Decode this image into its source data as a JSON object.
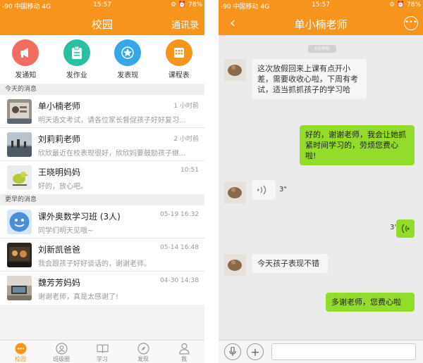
{
  "left": {
    "status": {
      "carrier": "-90 中国移动  4G",
      "time": "15:57",
      "battery": "⚙ ⏰ 78%"
    },
    "nav": {
      "title": "校园",
      "right": "通讯录"
    },
    "actions": [
      {
        "label": "发通知",
        "color": "#f26c5f",
        "icon": "megaphone-icon"
      },
      {
        "label": "发作业",
        "color": "#29c0a2",
        "icon": "clipboard-icon"
      },
      {
        "label": "发表现",
        "color": "#35a7e8",
        "icon": "star-badge-icon"
      },
      {
        "label": "课程表",
        "color": "#f7941d",
        "icon": "calendar-grid-icon"
      }
    ],
    "today_header": "今天的消息",
    "today": [
      {
        "name": "单小楠老师",
        "preview": "明天语文考试，请各位家长督促孩子好好复习...",
        "time": "1 小时前"
      },
      {
        "name": "刘莉莉老师",
        "preview": "欣欣最近在校表现很好，欣欣妈要鼓励孩子继...",
        "time": "2 小时前"
      },
      {
        "name": "王晓明妈妈",
        "preview": "好的，放心吧。",
        "time": "10:51"
      }
    ],
    "earlier_header": "更早的消息",
    "earlier": [
      {
        "name": "课外奥数学习班 (3人)",
        "preview": "同学们明天见哦~",
        "time": "05-19 16:32"
      },
      {
        "name": "刘新凯爸爸",
        "preview": "我会跟孩子好好谈话的，谢谢老师。",
        "time": "05-14 16:48"
      },
      {
        "name": "魏芳芳妈妈",
        "preview": "谢谢老师，真是太感谢了!",
        "time": "04-30 14:38"
      }
    ],
    "tabs": [
      {
        "label": "校园",
        "icon": "chat-bubble-icon"
      },
      {
        "label": "班级圈",
        "icon": "people-circle-icon"
      },
      {
        "label": "学习",
        "icon": "book-icon"
      },
      {
        "label": "发现",
        "icon": "compass-icon"
      },
      {
        "label": "我",
        "icon": "person-icon"
      }
    ]
  },
  "right": {
    "status": {
      "carrier": "-90 中国移动  4G",
      "time": "15:57",
      "battery": "⚙ ⏰ 78%"
    },
    "nav": {
      "title": "单小楠老师"
    },
    "time_pill": "6分钟前",
    "messages": {
      "m1": "这次放假回来上课有点开小差，需要收收心啦，下周有考试，适当抓抓孩子的学习哈",
      "m2": "好的，谢谢老师，我会让她抓紧时间学习的，劳烦您费心啦!",
      "m3_dur": "3\"",
      "m4_dur": "3\"",
      "m5": "今天孩子表现不错",
      "m6": "多谢老师，您费心啦"
    }
  },
  "colors": {
    "accent": "#f7941d",
    "outgoing_bubble": "#93dc2c"
  }
}
